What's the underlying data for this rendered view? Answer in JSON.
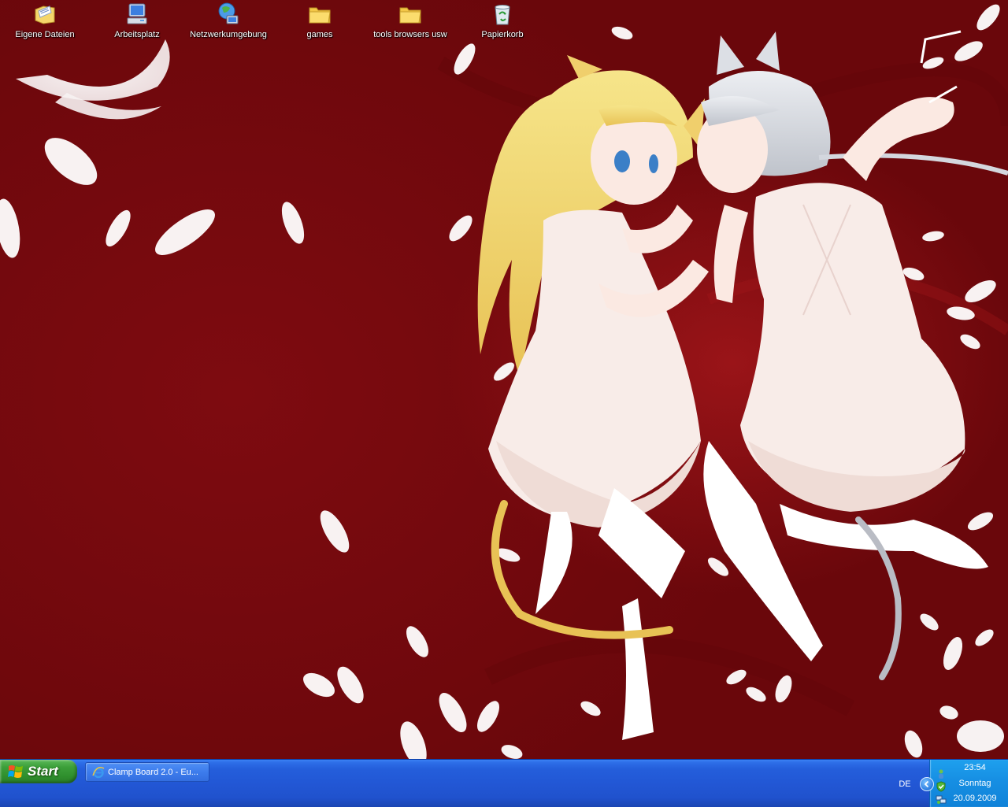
{
  "desktop": {
    "icons": [
      {
        "label": "Eigene Dateien",
        "icon": "my-documents-icon"
      },
      {
        "label": "Arbeitsplatz",
        "icon": "my-computer-icon"
      },
      {
        "label": "Netzwerkumgebung",
        "icon": "network-places-icon"
      },
      {
        "label": "games",
        "icon": "folder-icon"
      },
      {
        "label": "tools browsers usw",
        "icon": "folder-icon"
      },
      {
        "label": "Papierkorb",
        "icon": "recycle-bin-icon"
      }
    ]
  },
  "taskbar": {
    "start_label": "Start",
    "tasks": [
      {
        "label": "Clamp Board 2.0 - Eu...",
        "icon": "internet-explorer-icon"
      }
    ],
    "language": "DE"
  },
  "tray": {
    "time": "23:54",
    "weekday": "Sonntag",
    "date": "20.09.2009"
  },
  "colors": {
    "wallpaper_red": "#7a0a0f",
    "taskbar_blue": "#245edb",
    "start_green": "#3c9f3a",
    "tray_blue": "#1790e4"
  }
}
